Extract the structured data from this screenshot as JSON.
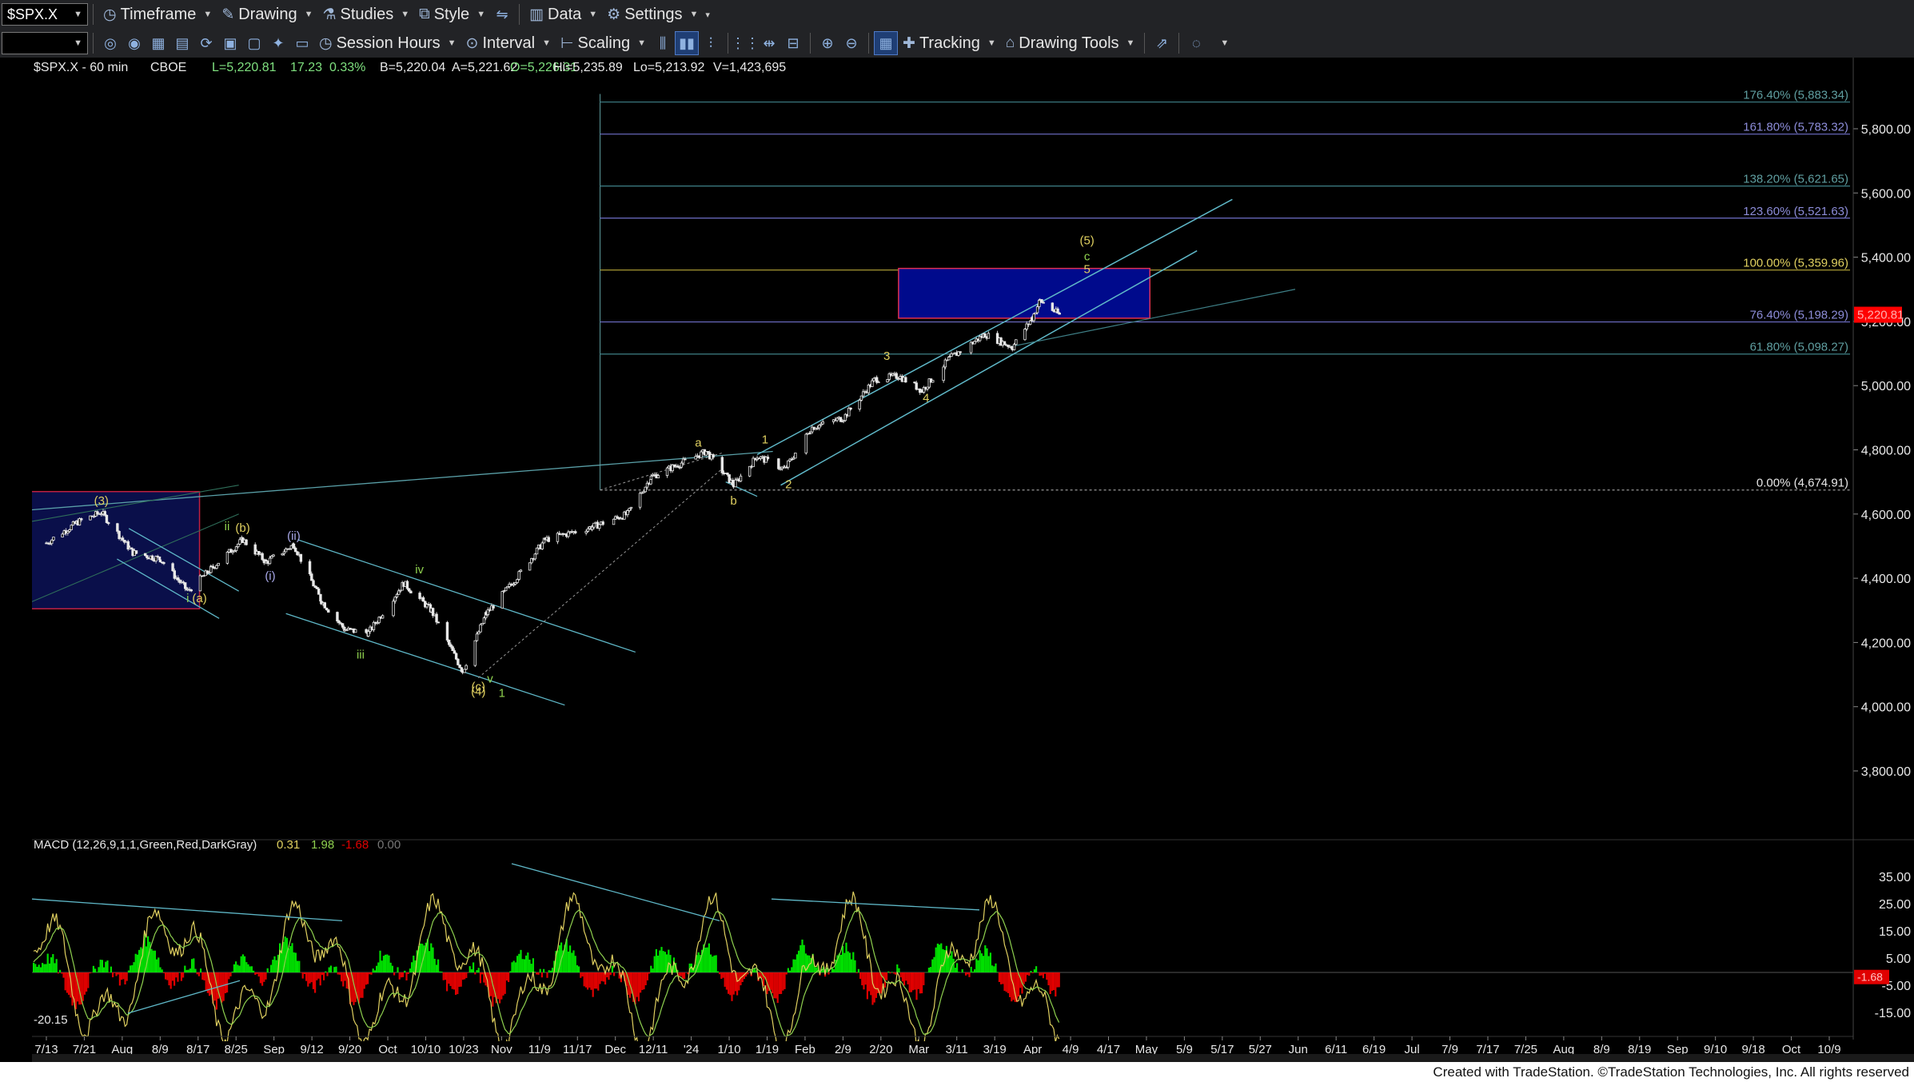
{
  "toolbar": {
    "symbol": "$SPX.X",
    "row1": [
      {
        "icon": "clock-icon",
        "label": "Timeframe"
      },
      {
        "icon": "pencil-icon",
        "label": "Drawing"
      },
      {
        "icon": "flask-icon",
        "label": "Studies"
      },
      {
        "icon": "style-icon",
        "label": "Style"
      },
      {
        "icon": "data-icon",
        "label": "Data"
      },
      {
        "icon": "gear-icon",
        "label": "Settings"
      }
    ],
    "row2": [
      {
        "icon": "session-icon",
        "label": "Session Hours"
      },
      {
        "icon": "interval-icon",
        "label": "Interval"
      },
      {
        "icon": "scaling-icon",
        "label": "Scaling"
      },
      {
        "icon": "crosshair-icon",
        "label": "Tracking"
      },
      {
        "icon": "drawing-tools-icon",
        "label": "Drawing Tools"
      }
    ]
  },
  "header": {
    "symbol": "$SPX.X - 60 min",
    "exchange": "CBOE",
    "last": "L=5,220.81",
    "change": "17.23",
    "change_pct": "0.33%",
    "bid": "B=5,220.04",
    "ask": "A=5,221.62",
    "open": "O=5,226.31",
    "high": "Hi=5,235.89",
    "low": "Lo=5,213.92",
    "volume": "V=1,423,695"
  },
  "macd_header": {
    "label": "MACD (12,26,9,1,1,Green,Red,DarkGray)",
    "v1": "0.31",
    "v2": "1.98",
    "v3": "-1.68",
    "v4": "0.00"
  },
  "footer": "Created with TradeStation. ©TradeStation Technologies, Inc. All rights reserved",
  "colors": {
    "background": "#000000",
    "price_line": "#e8e8e8",
    "fib_label": "#5f9ea0",
    "fib_purple": "#8c8cd8",
    "fib_100": "#e0d060",
    "wave_yellow": "#e0d060",
    "wave_green": "#8fd14f",
    "channel": "#5fb8c8",
    "target_box": "#000a8c",
    "hist_pos": "#00e000",
    "hist_neg": "#e00000",
    "last_price_tag": "#ff0000"
  },
  "chart_data": {
    "type": "candlestick",
    "timeframe": "60 min",
    "y_axis": {
      "ticks": [
        "5,800.00",
        "5,600.00",
        "5,400.00",
        "5,200.00",
        "5,000.00",
        "4,800.00",
        "4,600.00",
        "4,400.00",
        "4,200.00",
        "4,000.00",
        "3,800.00"
      ],
      "last_price_label": "5,220.81"
    },
    "x_axis": {
      "ticks": [
        "7/13",
        "7/21",
        "Aug",
        "8/9",
        "8/17",
        "8/25",
        "Sep",
        "9/12",
        "9/20",
        "Oct",
        "10/10",
        "10/23",
        "Nov",
        "11/9",
        "11/17",
        "Dec",
        "12/11",
        "'24",
        "1/10",
        "1/19",
        "Feb",
        "2/9",
        "2/20",
        "Mar",
        "3/11",
        "3/19",
        "Apr",
        "4/9",
        "4/17",
        "May",
        "5/9",
        "5/17",
        "5/27",
        "Jun",
        "6/11",
        "6/19",
        "Jul",
        "7/9",
        "7/17",
        "7/25",
        "Aug",
        "8/9",
        "8/19",
        "Sep",
        "9/10",
        "9/18",
        "Oct",
        "10/9"
      ]
    },
    "price_path": [
      [
        "2023-07-13",
        4510
      ],
      [
        "2023-07-21",
        4575
      ],
      [
        "2023-07-27",
        4605
      ],
      [
        "2023-08-04",
        4480
      ],
      [
        "2023-08-11",
        4460
      ],
      [
        "2023-08-18",
        4360
      ],
      [
        "2023-08-24",
        4430
      ],
      [
        "2023-09-01",
        4520
      ],
      [
        "2023-09-07",
        4450
      ],
      [
        "2023-09-14",
        4505
      ],
      [
        "2023-09-21",
        4330
      ],
      [
        "2023-09-27",
        4240
      ],
      [
        "2023-10-03",
        4230
      ],
      [
        "2023-10-12",
        4385
      ],
      [
        "2023-10-19",
        4300
      ],
      [
        "2023-10-27",
        4110
      ],
      [
        "2023-11-02",
        4290
      ],
      [
        "2023-11-09",
        4390
      ],
      [
        "2023-11-17",
        4520
      ],
      [
        "2023-11-29",
        4560
      ],
      [
        "2023-12-08",
        4600
      ],
      [
        "2023-12-14",
        4715
      ],
      [
        "2023-12-28",
        4795
      ],
      [
        "2024-01-04",
        4690
      ],
      [
        "2024-01-10",
        4780
      ],
      [
        "2024-01-17",
        4740
      ],
      [
        "2024-01-24",
        4870
      ],
      [
        "2024-02-01",
        4900
      ],
      [
        "2024-02-09",
        5020
      ],
      [
        "2024-02-15",
        5030
      ],
      [
        "2024-02-21",
        4985
      ],
      [
        "2024-02-28",
        5085
      ],
      [
        "2024-03-08",
        5160
      ],
      [
        "2024-03-15",
        5120
      ],
      [
        "2024-03-20",
        5210
      ],
      [
        "2024-03-22",
        5265
      ],
      [
        "2024-03-27",
        5220
      ]
    ],
    "fib_levels": [
      {
        "label": "176.40% (5,883.34)",
        "value": 5883.34
      },
      {
        "label": "161.80% (5,783.32)",
        "value": 5783.32
      },
      {
        "label": "138.20% (5,621.65)",
        "value": 5621.65
      },
      {
        "label": "123.60% (5,521.63)",
        "value": 5521.63
      },
      {
        "label": "100.00% (5,359.96)",
        "value": 5359.96
      },
      {
        "label": "76.40% (5,198.29)",
        "value": 5198.29
      },
      {
        "label": "61.80% (5,098.27)",
        "value": 5098.27
      },
      {
        "label": "0.00% (4,674.91)",
        "value": 4674.91
      }
    ],
    "target_box": {
      "from": "2024-02-15",
      "to": "2024-04-19",
      "low": 5210,
      "high": 5365
    },
    "history_box": {
      "from": "2023-07-06",
      "to": "2023-08-21",
      "low": 4305,
      "high": 4670
    },
    "wave_labels": [
      {
        "text": "(3)",
        "date": "2023-07-27",
        "price": 4630,
        "color": "yellow"
      },
      {
        "text": "ii",
        "date": "2023-08-28",
        "price": 4550,
        "color": "green"
      },
      {
        "text": "(b)",
        "date": "2023-09-01",
        "price": 4545,
        "color": "yellow"
      },
      {
        "text": "(i)",
        "date": "2023-09-08",
        "price": 4395,
        "color": "purple"
      },
      {
        "text": "(ii)",
        "date": "2023-09-14",
        "price": 4520,
        "color": "purple"
      },
      {
        "text": "i",
        "date": "2023-08-18",
        "price": 4325,
        "color": "green"
      },
      {
        "text": "(a)",
        "date": "2023-08-21",
        "price": 4325,
        "color": "yellow"
      },
      {
        "text": "iii",
        "date": "2023-10-01",
        "price": 4150,
        "color": "green"
      },
      {
        "text": "iv",
        "date": "2023-10-16",
        "price": 4415,
        "color": "green"
      },
      {
        "text": "(c)",
        "date": "2023-10-31",
        "price": 4050,
        "color": "yellow"
      },
      {
        "text": "(4)",
        "date": "2023-10-31",
        "price": 4035,
        "color": "yellow"
      },
      {
        "text": "v",
        "date": "2023-11-03",
        "price": 4075,
        "color": "green"
      },
      {
        "text": "1",
        "date": "2023-11-06",
        "price": 4030,
        "color": "green"
      },
      {
        "text": "a",
        "date": "2023-12-26",
        "price": 4810,
        "color": "yellow"
      },
      {
        "text": "b",
        "date": "2024-01-04",
        "price": 4630,
        "color": "yellow"
      },
      {
        "text": "1",
        "date": "2024-01-12",
        "price": 4820,
        "color": "yellow"
      },
      {
        "text": "2",
        "date": "2024-01-18",
        "price": 4680,
        "color": "yellow"
      },
      {
        "text": "3",
        "date": "2024-02-12",
        "price": 5080,
        "color": "yellow"
      },
      {
        "text": "4",
        "date": "2024-02-22",
        "price": 4950,
        "color": "yellow"
      },
      {
        "text": "(5)",
        "date": "2024-04-03",
        "price": 5440,
        "color": "yellow"
      },
      {
        "text": "c",
        "date": "2024-04-03",
        "price": 5390,
        "color": "green"
      },
      {
        "text": "5",
        "date": "2024-04-03",
        "price": 5350,
        "color": "yellow"
      }
    ],
    "macd": {
      "ticks": [
        "35.00",
        "25.00",
        "15.00",
        "5.00",
        "-5.00",
        "-15.00"
      ],
      "min_label": "-20.15",
      "last_value_label": "-1.68"
    }
  }
}
